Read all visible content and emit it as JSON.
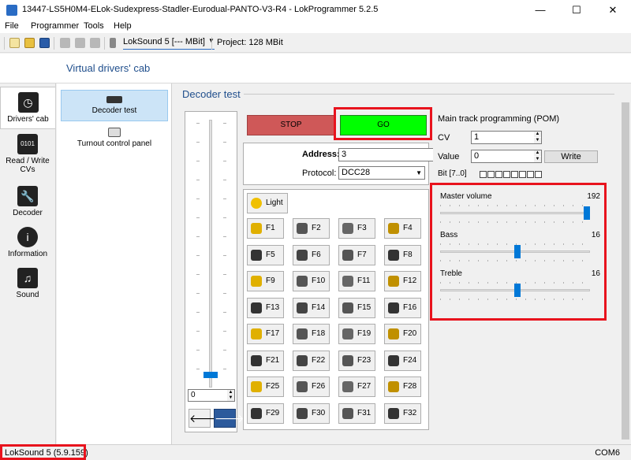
{
  "window": {
    "title": "13447-LS5H0M4-ELok-Sudexpress-Stadler-Eurodual-PANTO-V3-R4 - LokProgrammer 5.2.5",
    "minimize": "—",
    "maximize": "☐",
    "close": "✕"
  },
  "menu": [
    "File",
    "Programmer",
    "Tools",
    "Help"
  ],
  "toolbar": {
    "device_label": "LokSound 5 [--- MBit]",
    "project_label": "Project:  128 MBit"
  },
  "header": {
    "title": "Virtual drivers' cab"
  },
  "nav": [
    {
      "label": "Drivers' cab",
      "icon": "clock-icon"
    },
    {
      "label": "Read / Write CVs",
      "icon": "binary-icon"
    },
    {
      "label": "Decoder",
      "icon": "wrench-icon"
    },
    {
      "label": "Information",
      "icon": "info-icon"
    },
    {
      "label": "Sound",
      "icon": "music-icon"
    }
  ],
  "subnav": [
    {
      "label": "Decoder test",
      "icon": "locomotive-icon"
    },
    {
      "label": "Turnout control panel",
      "icon": "turnout-icon"
    }
  ],
  "content": {
    "title": "Decoder test"
  },
  "throttle": {
    "speed": "0",
    "level": 0.0,
    "back_arrow": "🡐",
    "fwd_arrow": "🡒"
  },
  "controls": {
    "stop": "STOP",
    "go": "GO"
  },
  "address": {
    "address_label": "Address:",
    "address_value": "3",
    "protocol_label": "Protocol:",
    "protocol_value": "DCC28"
  },
  "functions": {
    "light": "Light",
    "keys": [
      "F1",
      "F2",
      "F3",
      "F4",
      "F5",
      "F6",
      "F7",
      "F8",
      "F9",
      "F10",
      "F11",
      "F12",
      "F13",
      "F14",
      "F15",
      "F16",
      "F17",
      "F18",
      "F19",
      "F20",
      "F21",
      "F22",
      "F23",
      "F24",
      "F25",
      "F26",
      "F27",
      "F28",
      "F29",
      "F30",
      "F31",
      "F32"
    ]
  },
  "pom": {
    "title": "Main track programming (POM)",
    "cv_label": "CV",
    "cv_value": "1",
    "value_label": "Value",
    "value_value": "0",
    "write": "Write",
    "bit_label": "Bit [7..0]"
  },
  "sound": {
    "master_label": "Master volume",
    "master_value": "192",
    "bass_label": "Bass",
    "bass_value": "16",
    "treble_label": "Treble",
    "treble_value": "16"
  },
  "status": {
    "left": "LokSound 5 (5.9.159)",
    "right": "COM6"
  },
  "colors": {
    "go": "#00ff00",
    "stop": "#cf5858",
    "highlight": "#e8131d",
    "accent": "#0078d7"
  }
}
